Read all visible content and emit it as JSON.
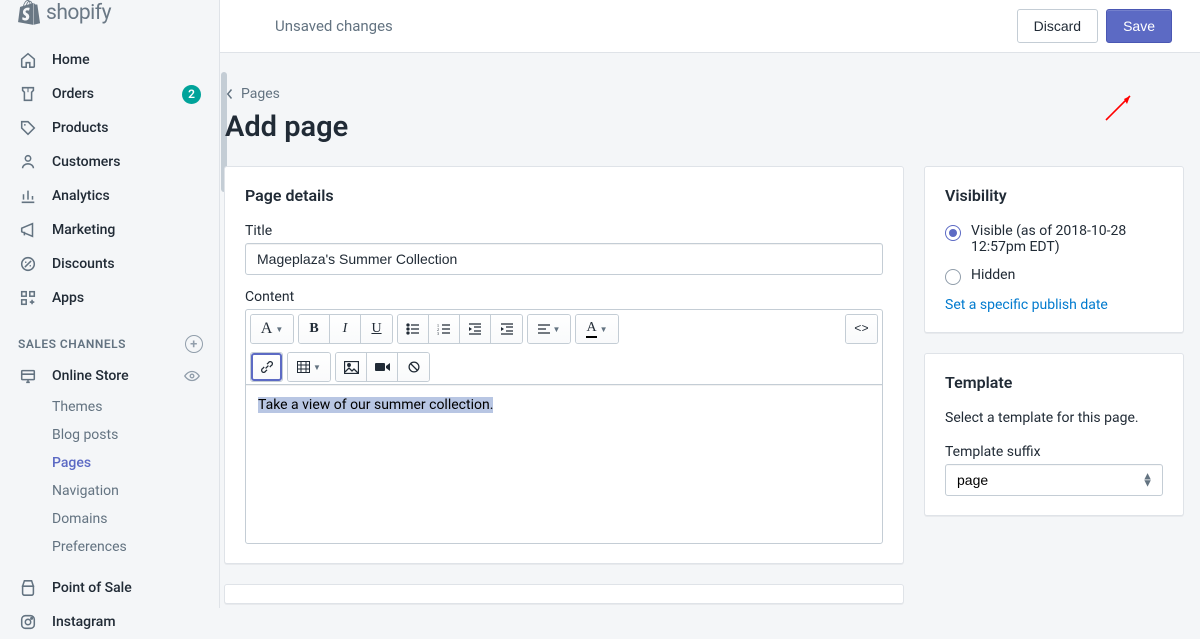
{
  "brand": "shopify",
  "topbar": {
    "status": "Unsaved changes",
    "discard": "Discard",
    "save": "Save"
  },
  "nav": {
    "items": [
      {
        "label": "Home"
      },
      {
        "label": "Orders",
        "badge": "2"
      },
      {
        "label": "Products"
      },
      {
        "label": "Customers"
      },
      {
        "label": "Analytics"
      },
      {
        "label": "Marketing"
      },
      {
        "label": "Discounts"
      },
      {
        "label": "Apps"
      }
    ],
    "channels_heading": "SALES CHANNELS",
    "online_store": "Online Store",
    "subnav": [
      {
        "label": "Themes"
      },
      {
        "label": "Blog posts"
      },
      {
        "label": "Pages"
      },
      {
        "label": "Navigation"
      },
      {
        "label": "Domains"
      },
      {
        "label": "Preferences"
      }
    ],
    "pos": "Point of Sale",
    "instagram": "Instagram"
  },
  "breadcrumb": "Pages",
  "page_title": "Add page",
  "details": {
    "heading": "Page details",
    "title_label": "Title",
    "title_value": "Mageplaza's Summer Collection",
    "content_label": "Content",
    "editor_text": "Take a view of our summer collection."
  },
  "visibility": {
    "heading": "Visibility",
    "visible": "Visible (as of 2018-10-28 12:57pm EDT)",
    "hidden": "Hidden",
    "link": "Set a specific publish date"
  },
  "template": {
    "heading": "Template",
    "help": "Select a template for this page.",
    "suffix_label": "Template suffix",
    "suffix_value": "page"
  }
}
